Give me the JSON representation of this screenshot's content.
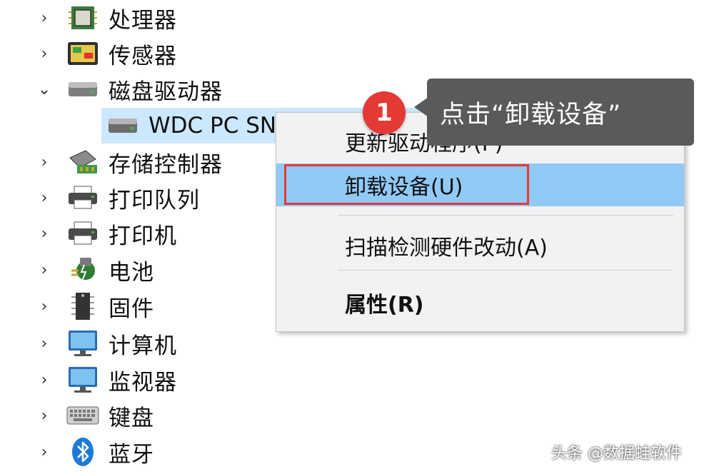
{
  "tree": {
    "items": [
      {
        "label": "处理器",
        "expanded": false,
        "icon": "processor-icon"
      },
      {
        "label": "传感器",
        "expanded": false,
        "icon": "sensor-icon"
      },
      {
        "label": "磁盘驱动器",
        "expanded": true,
        "icon": "disk-drive-icon"
      },
      {
        "label": "存储控制器",
        "expanded": false,
        "icon": "storage-controller-icon"
      },
      {
        "label": "打印队列",
        "expanded": false,
        "icon": "print-queue-icon"
      },
      {
        "label": "打印机",
        "expanded": false,
        "icon": "printer-icon"
      },
      {
        "label": "电池",
        "expanded": false,
        "icon": "battery-icon"
      },
      {
        "label": "固件",
        "expanded": false,
        "icon": "firmware-icon"
      },
      {
        "label": "计算机",
        "expanded": false,
        "icon": "computer-icon"
      },
      {
        "label": "监视器",
        "expanded": false,
        "icon": "monitor-icon"
      },
      {
        "label": "键盘",
        "expanded": false,
        "icon": "keyboard-icon"
      },
      {
        "label": "蓝牙",
        "expanded": false,
        "icon": "bluetooth-icon"
      }
    ],
    "child": {
      "label": "WDC PC SN",
      "icon": "disk-drive-icon"
    }
  },
  "context_menu": {
    "items": [
      {
        "label": "更新驱动程序(P)",
        "bold": false
      },
      {
        "label": "卸载设备(U)",
        "bold": false,
        "highlighted": true
      },
      {
        "label": "扫描检测硬件改动(A)",
        "bold": false
      },
      {
        "label": "属性(R)",
        "bold": true
      }
    ]
  },
  "annotation": {
    "badge": "1",
    "callout": "点击“卸载设备”"
  },
  "watermark": "头条 @数据蛙软件",
  "colors": {
    "selection": "#cce8ff",
    "menu_highlight": "#91c9f7",
    "red": "#e53935",
    "callout_bg": "#5a5a5a"
  }
}
